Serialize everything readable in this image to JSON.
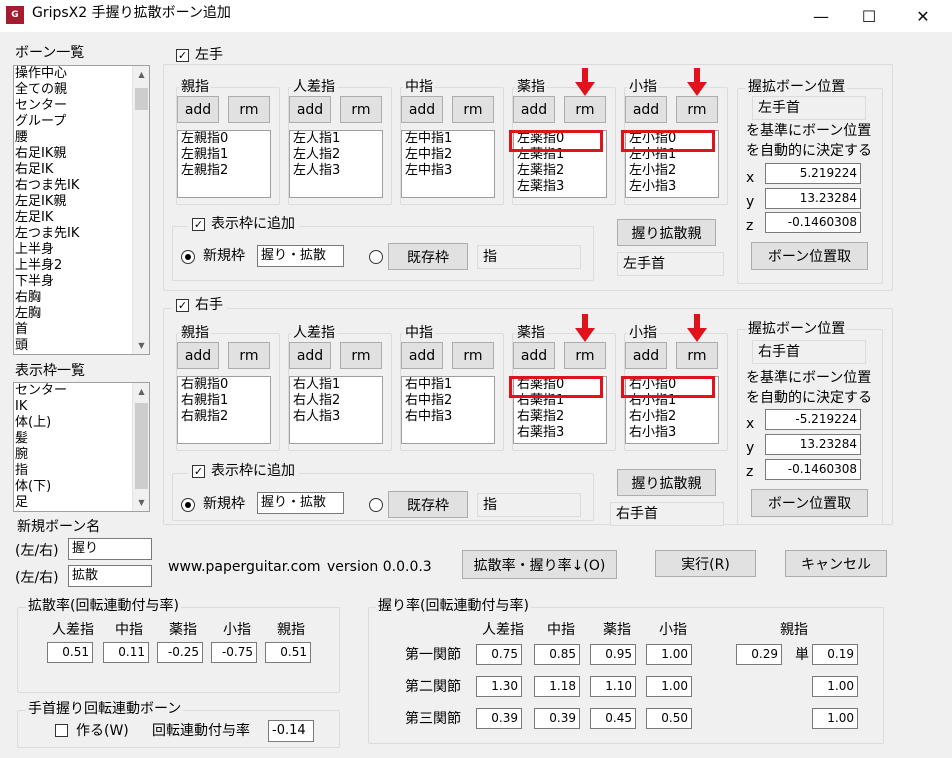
{
  "window": {
    "title": "GripsX2 手握り拡散ボーン追加",
    "minimize": "—",
    "maximize": "☐",
    "close": "✕"
  },
  "bone_list": {
    "label": "ボーン一覧",
    "items": [
      "操作中心",
      "全ての親",
      "センター",
      "グループ",
      "腰",
      "右足IK親",
      "右足IK",
      "右つま先IK",
      "左足IK親",
      "左足IK",
      "左つま先IK",
      "上半身",
      "上半身2",
      "下半身",
      "右胸",
      "左胸",
      "首",
      "頭"
    ]
  },
  "frame_list": {
    "label": "表示枠一覧",
    "items": [
      "センター",
      "IK",
      "体(上)",
      "髪",
      "腕",
      "指",
      "体(下)",
      "足"
    ]
  },
  "new_bone": {
    "label": "新規ボーン名",
    "prefix_label": "(左/右)",
    "grip_value": "握り",
    "spread_value": "拡散"
  },
  "left_hand": {
    "title": "左手",
    "fingers": [
      {
        "name": "親指",
        "items": [
          "左親指0",
          "左親指1",
          "左親指2"
        ]
      },
      {
        "name": "人差指",
        "items": [
          "左人指1",
          "左人指2",
          "左人指3"
        ]
      },
      {
        "name": "中指",
        "items": [
          "左中指1",
          "左中指2",
          "左中指3"
        ]
      },
      {
        "name": "薬指",
        "items": [
          "左薬指0",
          "左薬指1",
          "左薬指2",
          "左薬指3"
        ]
      },
      {
        "name": "小指",
        "items": [
          "左小指0",
          "左小指1",
          "左小指2",
          "左小指3"
        ]
      }
    ],
    "grip_pos": {
      "title": "握拡ボーン位置",
      "base_bone": "左手首",
      "desc1": "を基準にボーン位置",
      "desc2": "を自動的に決定する",
      "x_label": "x",
      "x": "5.219224",
      "y_label": "y",
      "y": "13.23284",
      "z_label": "z",
      "z": "-0.1460308",
      "get_button": "ボーン位置取"
    },
    "grip_parent_button": "握り拡散親",
    "grip_parent_value": "左手首",
    "add_frame_label": "表示枠に追加",
    "new_frame_label": "新規枠",
    "new_frame_value": "握り・拡散",
    "existing_frame_button": "既存枠",
    "existing_frame_value": "指"
  },
  "right_hand": {
    "title": "右手",
    "fingers": [
      {
        "name": "親指",
        "items": [
          "右親指0",
          "右親指1",
          "右親指2"
        ]
      },
      {
        "name": "人差指",
        "items": [
          "右人指1",
          "右人指2",
          "右人指3"
        ]
      },
      {
        "name": "中指",
        "items": [
          "右中指1",
          "右中指2",
          "右中指3"
        ]
      },
      {
        "name": "薬指",
        "items": [
          "右薬指0",
          "右薬指1",
          "右薬指2",
          "右薬指3"
        ]
      },
      {
        "name": "小指",
        "items": [
          "右小指0",
          "右小指1",
          "右小指2",
          "右小指3"
        ]
      }
    ],
    "grip_pos": {
      "title": "握拡ボーン位置",
      "base_bone": "右手首",
      "desc1": "を基準にボーン位置",
      "desc2": "を自動的に決定する",
      "x_label": "x",
      "x": "-5.219224",
      "y_label": "y",
      "y": "13.23284",
      "z_label": "z",
      "z": "-0.1460308",
      "get_button": "ボーン位置取"
    },
    "grip_parent_button": "握り拡散親",
    "grip_parent_value": "右手首",
    "add_frame_label": "表示枠に追加",
    "new_frame_label": "新規枠",
    "new_frame_value": "握り・拡散",
    "existing_frame_button": "既存枠",
    "existing_frame_value": "指"
  },
  "add_label": "add",
  "rm_label": "rm",
  "footer": {
    "url": "www.paperguitar.com",
    "version": "version 0.0.0.3",
    "rate_button": "拡散率・握り率↓(O)",
    "run_button": "実行(R)",
    "cancel_button": "キャンセル"
  },
  "spread_rate": {
    "title": "拡散率(回転連動付与率)",
    "headers": [
      "人差指",
      "中指",
      "薬指",
      "小指",
      "親指"
    ],
    "values": [
      "0.51",
      "0.11",
      "-0.25",
      "-0.75",
      "0.51"
    ]
  },
  "wrist": {
    "title": "手首握り回転連動ボーン",
    "create_label": "作る(W)",
    "rate_label": "回転連動付与率",
    "rate_value": "-0.14"
  },
  "grip_rate": {
    "title": "握り率(回転連動付与率)",
    "headers": [
      "人差指",
      "中指",
      "薬指",
      "小指",
      "親指"
    ],
    "single_label": "単",
    "rows": [
      {
        "label": "第一関節",
        "values": [
          "0.75",
          "0.85",
          "0.95",
          "1.00"
        ],
        "thumb": "0.29",
        "thumb_single": "0.19"
      },
      {
        "label": "第二関節",
        "values": [
          "1.30",
          "1.18",
          "1.10",
          "1.00"
        ],
        "thumb_single": "1.00"
      },
      {
        "label": "第三関節",
        "values": [
          "0.39",
          "0.39",
          "0.45",
          "0.50"
        ],
        "thumb_single": "1.00"
      }
    ]
  }
}
